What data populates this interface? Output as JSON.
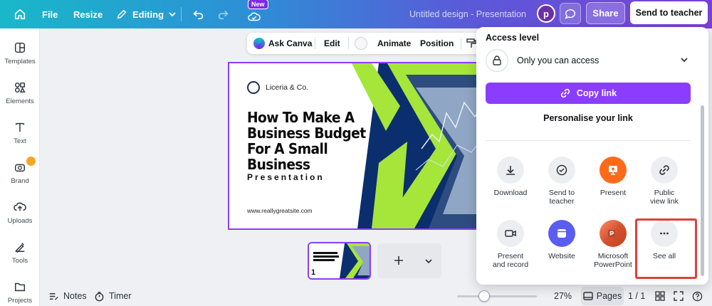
{
  "topbar": {
    "file": "File",
    "resize": "Resize",
    "editing": "Editing",
    "new_badge": "New",
    "doc_title": "Untitled design - Presentation",
    "avatar_letter": "p",
    "share": "Share",
    "send_to_teacher": "Send to teacher"
  },
  "sidebar": {
    "items": [
      {
        "label": "Templates",
        "icon": "templates-icon"
      },
      {
        "label": "Elements",
        "icon": "elements-icon"
      },
      {
        "label": "Text",
        "icon": "text-icon"
      },
      {
        "label": "Brand",
        "icon": "brand-icon"
      },
      {
        "label": "Uploads",
        "icon": "uploads-icon"
      },
      {
        "label": "Tools",
        "icon": "tools-icon"
      },
      {
        "label": "Projects",
        "icon": "projects-icon"
      }
    ]
  },
  "canvas_toolbar": {
    "ask_canva": "Ask Canva",
    "edit": "Edit",
    "animate": "Animate",
    "position": "Position"
  },
  "slide": {
    "brand": "Liceria & Co.",
    "title": "How To Make A Business Budget For A Small Business",
    "subtitle": "Presentation",
    "url": "www.reallygreatsite.com"
  },
  "pages": {
    "thumb_number": "1"
  },
  "bottombar": {
    "notes": "Notes",
    "timer": "Timer",
    "zoom": "27%",
    "zoom_level": 0.27,
    "pages": "Pages",
    "page_count": "1 / 1"
  },
  "share_panel": {
    "access_heading": "Access level",
    "access_value": "Only you can access",
    "copy_link": "Copy link",
    "personalise": "Personalise your link",
    "options": [
      {
        "label": "Download",
        "icon": "download-icon"
      },
      {
        "label": "Send to teacher",
        "icon": "check-circle-icon"
      },
      {
        "label": "Present",
        "icon": "present-icon"
      },
      {
        "label": "Public view link",
        "icon": "link-icon"
      },
      {
        "label": "Present and record",
        "icon": "camera-icon"
      },
      {
        "label": "Website",
        "icon": "website-icon"
      },
      {
        "label": "Microsoft PowerPoint",
        "icon": "powerpoint-icon"
      },
      {
        "label": "See all",
        "icon": "more-icon"
      }
    ]
  },
  "colors": {
    "accent": "#8b3dff",
    "present": "#ff6a1a",
    "website": "#5b5cf0",
    "powerpoint": "#c43e1c",
    "slide_green": "#a6e63a",
    "slide_navy": "#0b2e6e",
    "highlight": "#e0403a"
  }
}
